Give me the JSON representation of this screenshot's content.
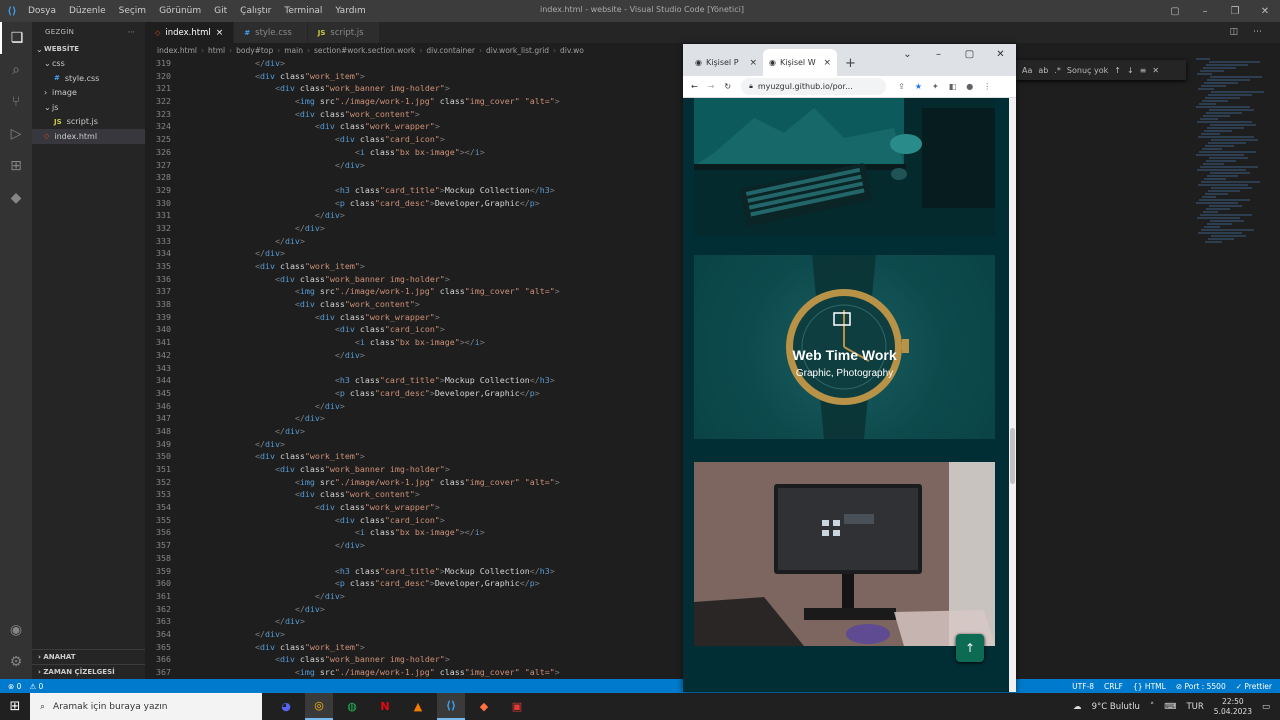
{
  "vscode": {
    "menu": [
      "Dosya",
      "Düzenle",
      "Seçim",
      "Görünüm",
      "Git",
      "Çalıştır",
      "Terminal",
      "Yardım"
    ],
    "window_title": "index.html - website - Visual Studio Code [Yönetici]",
    "sidebar_title": "GEZGİN",
    "tree": [
      {
        "label": "WEBSİTE",
        "indent": 4,
        "bold": true,
        "arrow": "⌄"
      },
      {
        "label": "css",
        "indent": 12,
        "arrow": "⌄"
      },
      {
        "label": "style.css",
        "indent": 22,
        "icon": "#",
        "iconcolor": "#42a5f5"
      },
      {
        "label": "image",
        "indent": 12,
        "arrow": "›"
      },
      {
        "label": "js",
        "indent": 12,
        "arrow": "⌄"
      },
      {
        "label": "script.js",
        "indent": 22,
        "icon": "JS",
        "iconcolor": "#cbcb41"
      },
      {
        "label": "index.html",
        "indent": 12,
        "icon": "◇",
        "iconcolor": "#e44d26",
        "selected": true
      }
    ],
    "outline": "ANAHAT",
    "timeline": "ZAMAN ÇİZELGESİ",
    "tabs": [
      {
        "label": "index.html",
        "icon": "◇",
        "iconcolor": "#e44d26",
        "active": true,
        "close": "×"
      },
      {
        "label": "style.css",
        "icon": "#",
        "iconcolor": "#42a5f5",
        "active": false,
        "close": ""
      },
      {
        "label": "script.js",
        "icon": "JS",
        "iconcolor": "#cbcb41",
        "active": false,
        "close": ""
      }
    ],
    "breadcrumb": [
      "index.html",
      "html",
      "body#top",
      "main",
      "section#work.section.work",
      "div.container",
      "div.work_list.grid",
      "div.wo"
    ],
    "find_text": "Sonuç yok",
    "status_left": [
      "⊗ 0",
      "⚠ 0"
    ],
    "status_right": [
      "UTF-8",
      "CRLF",
      "{} HTML",
      "⊘ Port : 5500",
      "✓ Prettier"
    ],
    "first_line_number": 319,
    "code_lines": [
      [
        12,
        "</div>"
      ],
      [
        12,
        "<div class=\"work_item\">"
      ],
      [
        16,
        "<div class=\"work_banner img-holder\">"
      ],
      [
        20,
        "<img src=\"./image/work-1.jpg\" class=\"img_cover\" \"alt=\"\">"
      ],
      [
        20,
        "<div class=\"work_content\">"
      ],
      [
        24,
        "<div class=\"work_wrapper\">"
      ],
      [
        28,
        "<div class=\"card_icon\">"
      ],
      [
        32,
        "<i class=\"bx bx-image\"></i>"
      ],
      [
        28,
        "</div>"
      ],
      [
        0,
        ""
      ],
      [
        28,
        "<h3 class=\"card_title\">Mockup Collection</h3>"
      ],
      [
        28,
        "<p class=\"card_desc\">Developer,Graphic</p>"
      ],
      [
        24,
        "</div>"
      ],
      [
        20,
        "</div>"
      ],
      [
        16,
        "</div>"
      ],
      [
        12,
        "</div>"
      ],
      [
        12,
        "<div class=\"work_item\">"
      ],
      [
        16,
        "<div class=\"work_banner img-holder\">"
      ],
      [
        20,
        "<img src=\"./image/work-1.jpg\" class=\"img_cover\" \"alt=\"\">"
      ],
      [
        20,
        "<div class=\"work_content\">"
      ],
      [
        24,
        "<div class=\"work_wrapper\">"
      ],
      [
        28,
        "<div class=\"card_icon\">"
      ],
      [
        32,
        "<i class=\"bx bx-image\"></i>"
      ],
      [
        28,
        "</div>"
      ],
      [
        0,
        ""
      ],
      [
        28,
        "<h3 class=\"card_title\">Mockup Collection</h3>"
      ],
      [
        28,
        "<p class=\"card_desc\">Developer,Graphic</p>"
      ],
      [
        24,
        "</div>"
      ],
      [
        20,
        "</div>"
      ],
      [
        16,
        "</div>"
      ],
      [
        12,
        "</div>"
      ],
      [
        12,
        "<div class=\"work_item\">"
      ],
      [
        16,
        "<div class=\"work_banner img-holder\">"
      ],
      [
        20,
        "<img src=\"./image/work-1.jpg\" class=\"img_cover\" \"alt=\"\">"
      ],
      [
        20,
        "<div class=\"work_content\">"
      ],
      [
        24,
        "<div class=\"work_wrapper\">"
      ],
      [
        28,
        "<div class=\"card_icon\">"
      ],
      [
        32,
        "<i class=\"bx bx-image\"></i>"
      ],
      [
        28,
        "</div>"
      ],
      [
        0,
        ""
      ],
      [
        28,
        "<h3 class=\"card_title\">Mockup Collection</h3>"
      ],
      [
        28,
        "<p class=\"card_desc\">Developer,Graphic</p>"
      ],
      [
        24,
        "</div>"
      ],
      [
        20,
        "</div>"
      ],
      [
        16,
        "</div>"
      ],
      [
        12,
        "</div>"
      ],
      [
        12,
        "<div class=\"work_item\">"
      ],
      [
        16,
        "<div class=\"work_banner img-holder\">"
      ],
      [
        20,
        "<img src=\"./image/work-1.jpg\" class=\"img_cover\" \"alt=\"\">"
      ]
    ]
  },
  "browser": {
    "tabs": [
      {
        "label": "Kişisel P",
        "active": false
      },
      {
        "label": "Kişisel W",
        "active": true
      }
    ],
    "url": "myuzgul.github.io/por...",
    "card_title": "Web Time Work",
    "card_desc": "Graphic, Photography"
  },
  "taskbar": {
    "search_placeholder": "Aramak için buraya yazın",
    "weather": "9°C  Bulutlu",
    "lang": "TUR",
    "time": "22:50",
    "date": "5.04.2023"
  },
  "colors": {
    "statusbar": "#007acc",
    "page_bg": "#012e35",
    "accent_button": "#0c6b52"
  }
}
